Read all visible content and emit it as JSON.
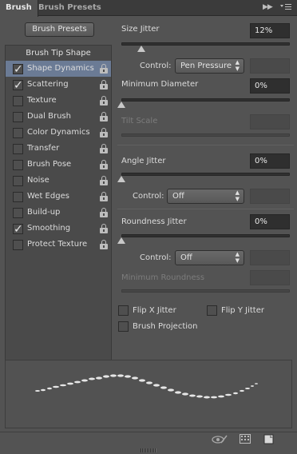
{
  "tabs": {
    "active": "Brush",
    "inactive": "Brush Presets"
  },
  "tab_icons": {
    "collapse": "double-chevron-right-icon",
    "menu": "panel-menu-icon"
  },
  "brush_presets_button": "Brush Presets",
  "options_header": "Brush Tip Shape",
  "options": [
    {
      "label": "Shape Dynamics",
      "checked": true,
      "selected": true
    },
    {
      "label": "Scattering",
      "checked": true,
      "selected": false
    },
    {
      "label": "Texture",
      "checked": false,
      "selected": false
    },
    {
      "label": "Dual Brush",
      "checked": false,
      "selected": false
    },
    {
      "label": "Color Dynamics",
      "checked": false,
      "selected": false
    },
    {
      "label": "Transfer",
      "checked": false,
      "selected": false
    },
    {
      "label": "Brush Pose",
      "checked": false,
      "selected": false
    },
    {
      "label": "Noise",
      "checked": false,
      "selected": false
    },
    {
      "label": "Wet Edges",
      "checked": false,
      "selected": false
    },
    {
      "label": "Build-up",
      "checked": false,
      "selected": false
    },
    {
      "label": "Smoothing",
      "checked": true,
      "selected": false
    },
    {
      "label": "Protect Texture",
      "checked": false,
      "selected": false
    }
  ],
  "size_jitter": {
    "label": "Size Jitter",
    "value": "12%",
    "slider": 0.12
  },
  "size_control": {
    "label": "Control:",
    "value": "Pen Pressure"
  },
  "minimum_diameter": {
    "label": "Minimum Diameter",
    "value": "0%",
    "slider": 0
  },
  "tilt_scale": {
    "label": "Tilt Scale",
    "enabled": false
  },
  "angle_jitter": {
    "label": "Angle Jitter",
    "value": "0%",
    "slider": 0
  },
  "angle_control": {
    "label": "Control:",
    "value": "Off"
  },
  "roundness_jitter": {
    "label": "Roundness Jitter",
    "value": "0%",
    "slider": 0
  },
  "roundness_control": {
    "label": "Control:",
    "value": "Off"
  },
  "minimum_roundness": {
    "label": "Minimum Roundness",
    "enabled": false
  },
  "flip_x": {
    "label": "Flip X Jitter",
    "checked": false
  },
  "flip_y": {
    "label": "Flip Y Jitter",
    "checked": false
  },
  "brush_projection": {
    "label": "Brush Projection",
    "checked": false
  },
  "bottom_icons": [
    "toggle-live-tip-icon",
    "brush-grid-icon",
    "create-new-brush-icon"
  ],
  "colors": {
    "panel": "#535353",
    "selected_row": "#6b7b95",
    "field": "#2f2f2f"
  }
}
